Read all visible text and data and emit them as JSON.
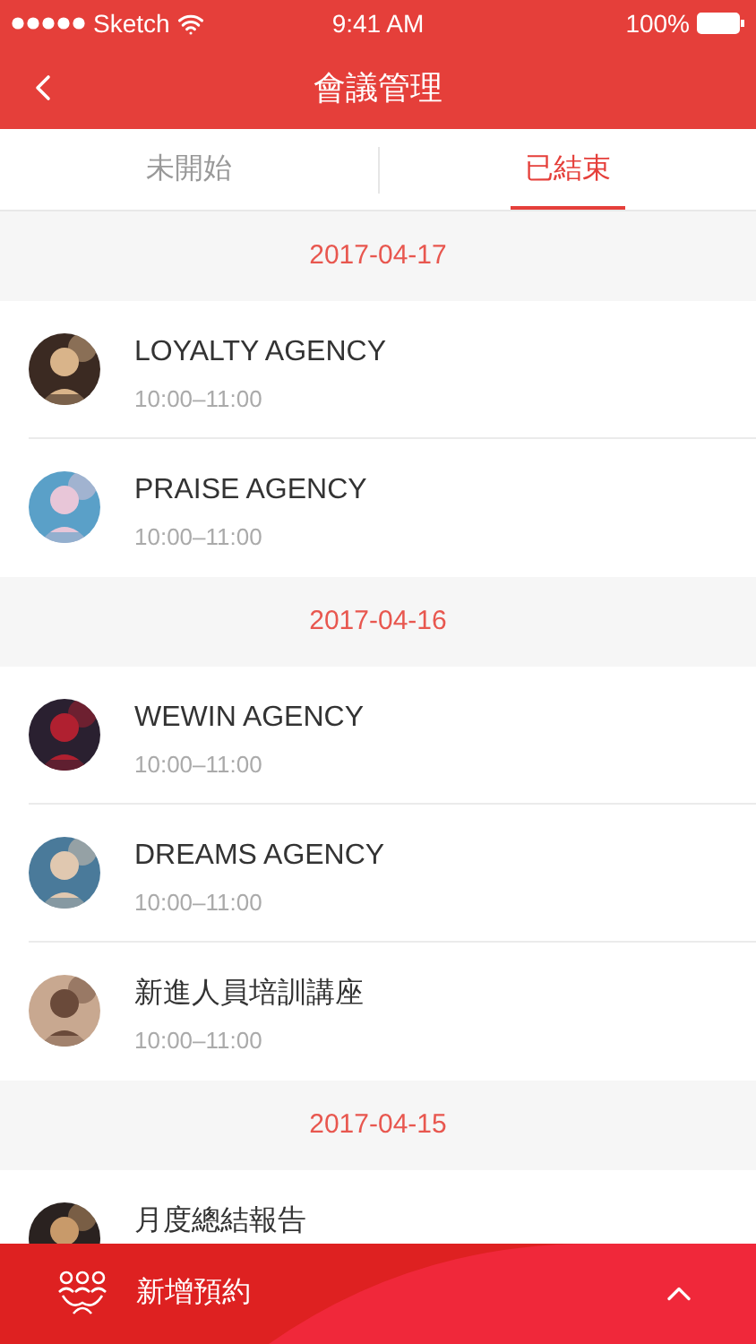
{
  "status_bar": {
    "carrier": "Sketch",
    "time": "9:41 AM",
    "battery": "100%"
  },
  "nav": {
    "title": "會議管理"
  },
  "tabs": [
    {
      "label": "未開始",
      "selected": false
    },
    {
      "label": "已結束",
      "selected": true
    }
  ],
  "groups": [
    {
      "date": "2017-04-17",
      "meetings": [
        {
          "title": "LOYALTY AGENCY",
          "time": "10:00–11:00"
        },
        {
          "title": "PRAISE AGENCY",
          "time": "10:00–11:00"
        }
      ]
    },
    {
      "date": "2017-04-16",
      "meetings": [
        {
          "title": "WEWIN AGENCY",
          "time": "10:00–11:00"
        },
        {
          "title": "DREAMS AGENCY",
          "time": "10:00–11:00"
        },
        {
          "title": "新進人員培訓講座",
          "time": "10:00–11:00"
        }
      ]
    },
    {
      "date": "2017-04-15",
      "meetings": [
        {
          "title": "月度總結報告"
        }
      ]
    }
  ],
  "bottom_bar": {
    "label": "新增預約"
  }
}
